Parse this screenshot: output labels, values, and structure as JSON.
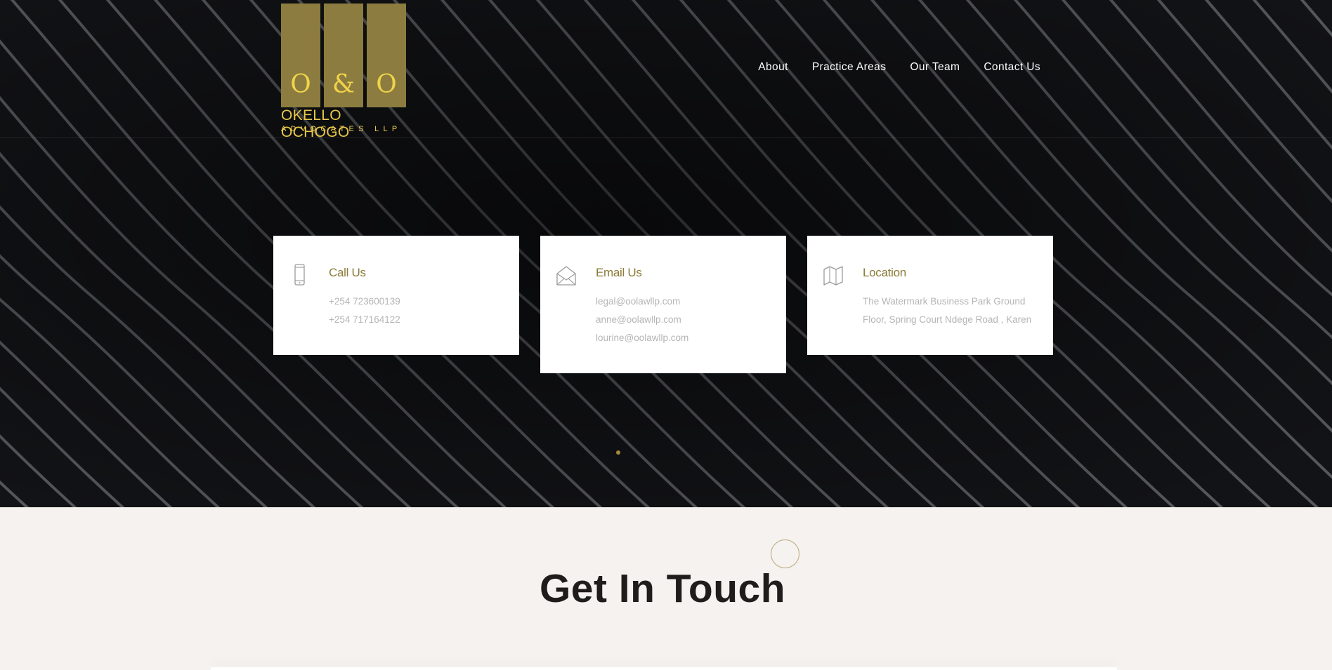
{
  "brand": {
    "glyphs": [
      "O",
      "&",
      "O"
    ],
    "name": "OKELLO OCHOGO",
    "subtitle": "ADVOCATES LLP",
    "bar_color": "#8c7c3f",
    "text_color": "#e8c84a"
  },
  "nav": {
    "items": [
      {
        "label": "About"
      },
      {
        "label": "Practice Areas"
      },
      {
        "label": "Our Team"
      },
      {
        "label": "Contact Us"
      }
    ]
  },
  "contact_cards": [
    {
      "icon": "mobile-phone-icon",
      "title": "Call Us",
      "lines": [
        "+254 723600139",
        "+254 717164122"
      ]
    },
    {
      "icon": "envelope-icon",
      "title": "Email Us",
      "lines": [
        "legal@oolawllp.com",
        "anne@oolawllp.com",
        "lourine@oolawllp.com"
      ]
    },
    {
      "icon": "map-icon",
      "title": "Location",
      "lines": [
        "The Watermark Business Park Ground",
        "Floor, Spring Court Ndege Road , Karen"
      ]
    }
  ],
  "section": {
    "title": "Get In Touch"
  },
  "colors": {
    "hero_bg": "#121316",
    "accent": "#8b7a38",
    "section_bg": "#f6f2f0"
  }
}
